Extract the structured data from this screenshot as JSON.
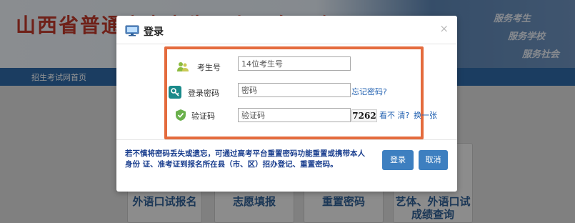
{
  "background": {
    "site_title": "山西省普通高考考生网上服务平台",
    "slogans": [
      "服务考生",
      "服务学校",
      "服务社会"
    ],
    "nav_item": "招生考试网首页",
    "cards": [
      "外语口试报名",
      "志愿填报",
      "重置密码",
      "艺体、外语口试成绩查询"
    ]
  },
  "dialog": {
    "title": "登录",
    "close": "×",
    "fields": {
      "exam_id": {
        "label": "考生号",
        "placeholder": "14位考生号"
      },
      "password": {
        "label": "登录密码",
        "placeholder": "密码",
        "forgot": "忘记密码?"
      },
      "captcha": {
        "label": "验证码",
        "placeholder": "验证码",
        "code": "7262",
        "unclear": "看不 清?",
        "refresh": "换一张"
      }
    },
    "notice": "若不慎将密码丢失或遗忘，可通过高考平台重置密码功能重置或携带本人身份 证、准考证到报名所在县（市、区）招办登记、重置密码。",
    "buttons": {
      "login": "登录",
      "cancel": "取消"
    }
  },
  "colors": {
    "highlight_border": "#e46b3d",
    "primary_button": "#3d7fc0",
    "title_red": "#c0392b",
    "link_blue": "#1f5fb0",
    "notice_blue": "#1b3f8f"
  },
  "icons": [
    "monitor-icon",
    "users-icon",
    "key-icon",
    "shield-check-icon"
  ]
}
